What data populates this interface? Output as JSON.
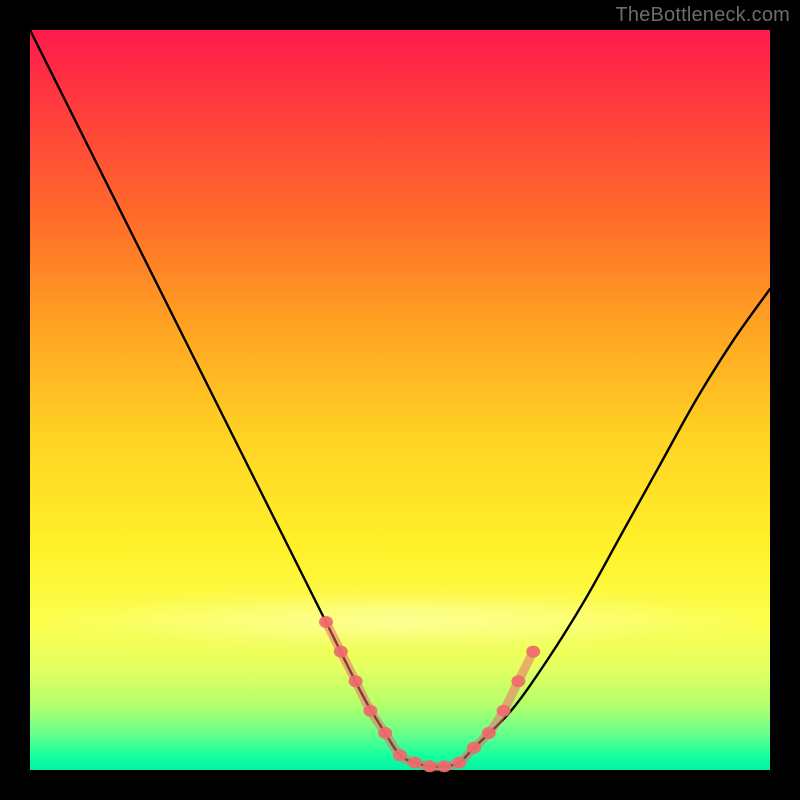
{
  "watermark": "TheBottleneck.com",
  "colors": {
    "frame": "#000000",
    "curve": "#000000",
    "marker": "#ee6b6b",
    "gradient_top": "#ff1a4d",
    "gradient_mid": "#ffd324",
    "gradient_bottom": "#00f3a6"
  },
  "chart_data": {
    "type": "line",
    "title": "",
    "xlabel": "",
    "ylabel": "",
    "xlim": [
      0,
      100
    ],
    "ylim": [
      0,
      100
    ],
    "grid": false,
    "legend": false,
    "series": [
      {
        "name": "bottleneck-curve",
        "x": [
          0,
          5,
          10,
          15,
          20,
          25,
          30,
          35,
          40,
          45,
          48,
          50,
          52,
          54,
          56,
          58,
          60,
          65,
          70,
          75,
          80,
          85,
          90,
          95,
          100
        ],
        "y": [
          100,
          90,
          80,
          70,
          60,
          50,
          40,
          30,
          20,
          10,
          5,
          2,
          1,
          0.5,
          0.5,
          1,
          3,
          8,
          15,
          23,
          32,
          41,
          50,
          58,
          65
        ]
      }
    ],
    "markers": {
      "name": "highlighted-points",
      "x": [
        40,
        42,
        44,
        46,
        48,
        50,
        52,
        54,
        56,
        58,
        60,
        62,
        64,
        66,
        68
      ],
      "y": [
        20,
        16,
        12,
        8,
        5,
        2,
        1,
        0.5,
        0.5,
        1,
        3,
        5,
        8,
        12,
        16
      ],
      "style": "pink-dots"
    }
  }
}
